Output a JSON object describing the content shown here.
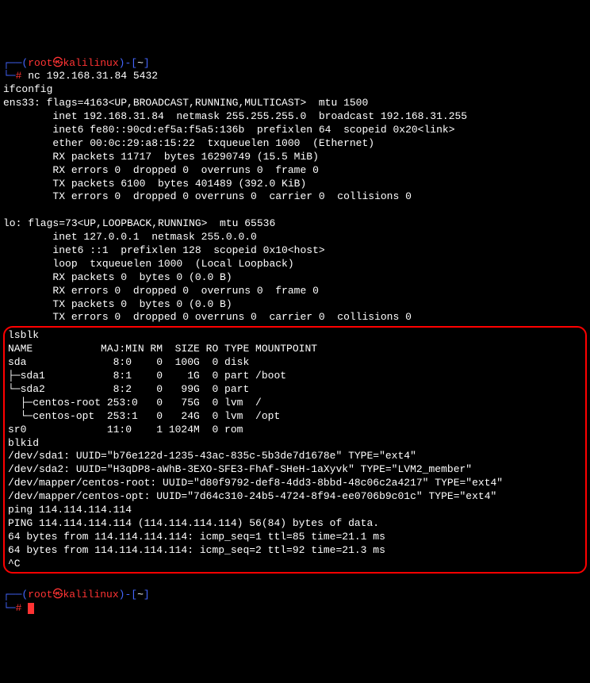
{
  "prompt1": {
    "dash": "┌──(",
    "user": "root",
    "at": "㉿",
    "host": "kalilinux",
    "close": ")-[",
    "path": "~",
    "end": "]",
    "line2_prefix": "└─",
    "hash": "#",
    "command": "nc 192.168.31.84 5432"
  },
  "output1": "ifconfig\nens33: flags=4163<UP,BROADCAST,RUNNING,MULTICAST>  mtu 1500\n        inet 192.168.31.84  netmask 255.255.255.0  broadcast 192.168.31.255\n        inet6 fe80::90cd:ef5a:f5a5:136b  prefixlen 64  scopeid 0x20<link>\n        ether 00:0c:29:a8:15:22  txqueuelen 1000  (Ethernet)\n        RX packets 11717  bytes 16290749 (15.5 MiB)\n        RX errors 0  dropped 0  overruns 0  frame 0\n        TX packets 6100  bytes 401489 (392.0 KiB)\n        TX errors 0  dropped 0 overruns 0  carrier 0  collisions 0\n\nlo: flags=73<UP,LOOPBACK,RUNNING>  mtu 65536\n        inet 127.0.0.1  netmask 255.0.0.0\n        inet6 ::1  prefixlen 128  scopeid 0x10<host>\n        loop  txqueuelen 1000  (Local Loopback)\n        RX packets 0  bytes 0 (0.0 B)\n        RX errors 0  dropped 0  overruns 0  frame 0\n        TX packets 0  bytes 0 (0.0 B)\n        TX errors 0  dropped 0 overruns 0  carrier 0  collisions 0\n",
  "boxed": "lsblk\nNAME           MAJ:MIN RM  SIZE RO TYPE MOUNTPOINT\nsda              8:0    0  100G  0 disk\n├─sda1           8:1    0    1G  0 part /boot\n└─sda2           8:2    0   99G  0 part\n  ├─centos-root 253:0   0   75G  0 lvm  /\n  └─centos-opt  253:1   0   24G  0 lvm  /opt\nsr0             11:0    1 1024M  0 rom\nblkid\n/dev/sda1: UUID=\"b76e122d-1235-43ac-835c-5b3de7d1678e\" TYPE=\"ext4\"\n/dev/sda2: UUID=\"H3qDP8-aWhB-3EXO-SFE3-FhAf-SHeH-1aXyvk\" TYPE=\"LVM2_member\"\n/dev/mapper/centos-root: UUID=\"d80f9792-def8-4dd3-8bbd-48c06c2a4217\" TYPE=\"ext4\"\n/dev/mapper/centos-opt: UUID=\"7d64c310-24b5-4724-8f94-ee0706b9c01c\" TYPE=\"ext4\"\nping 114.114.114.114\nPING 114.114.114.114 (114.114.114.114) 56(84) bytes of data.\n64 bytes from 114.114.114.114: icmp_seq=1 ttl=85 time=21.1 ms\n64 bytes from 114.114.114.114: icmp_seq=2 ttl=92 time=21.3 ms\n^C",
  "prompt2": {
    "dash": "┌──(",
    "user": "root",
    "at": "㉿",
    "host": "kalilinux",
    "close": ")-[",
    "path": "~",
    "end": "]",
    "line2_prefix": "└─",
    "hash": "#"
  }
}
